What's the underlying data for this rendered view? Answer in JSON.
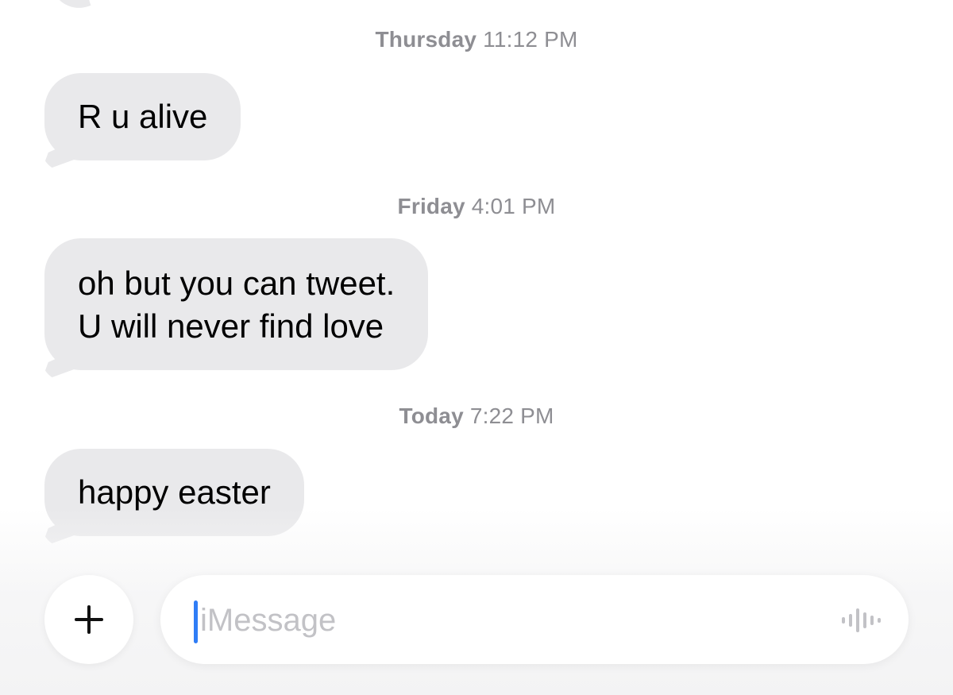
{
  "thread": {
    "messages": [
      {
        "day": "Thursday",
        "time": "11:12 PM",
        "lines": [
          "R u alive"
        ]
      },
      {
        "day": "Friday",
        "time": "4:01 PM",
        "lines": [
          "oh but you can tweet.",
          "U will never find love"
        ]
      },
      {
        "day": "Today",
        "time": "7:22 PM",
        "lines": [
          "happy easter"
        ]
      }
    ]
  },
  "composer": {
    "placeholder": "iMessage",
    "add_icon": "plus-icon",
    "audio_icon": "waveform-icon"
  },
  "colors": {
    "incoming_bubble": "#e9e9eb",
    "timestamp": "#8e8e93",
    "caret": "#2f7df6",
    "placeholder": "#c2c2c6"
  }
}
